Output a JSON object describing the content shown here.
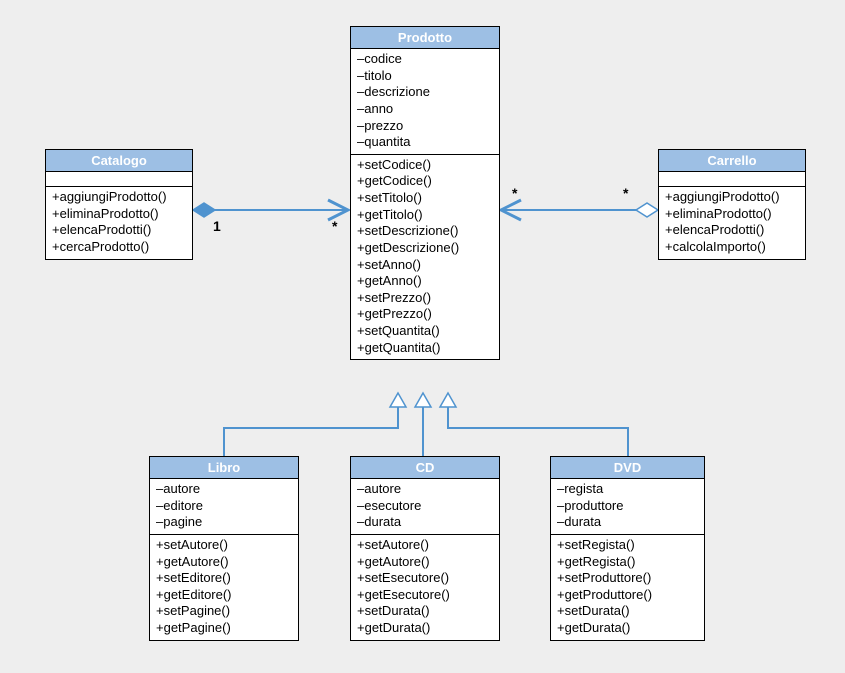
{
  "classes": {
    "prodotto": {
      "title": "Prodotto",
      "attrs": [
        "–codice",
        "–titolo",
        "–descrizione",
        "–anno",
        "–prezzo",
        "–quantita"
      ],
      "ops": [
        "+setCodice()",
        "+getCodice()",
        "+setTitolo()",
        "+getTitolo()",
        "+setDescrizione()",
        "+getDescrizione()",
        "+setAnno()",
        "+getAnno()",
        "+setPrezzo()",
        "+getPrezzo()",
        "+setQuantita()",
        "+getQuantita()"
      ]
    },
    "catalogo": {
      "title": "Catalogo",
      "attrs": [],
      "ops": [
        "+aggiungiProdotto()",
        "+eliminaProdotto()",
        "+elencaProdotti()",
        "+cercaProdotto()"
      ]
    },
    "carrello": {
      "title": "Carrello",
      "attrs": [],
      "ops": [
        "+aggiungiProdotto()",
        "+eliminaProdotto()",
        "+elencaProdotti()",
        "+calcolaImporto()"
      ]
    },
    "libro": {
      "title": "Libro",
      "attrs": [
        "–autore",
        "–editore",
        "–pagine"
      ],
      "ops": [
        "+setAutore()",
        "+getAutore()",
        "+setEditore()",
        "+getEditore()",
        "+setPagine()",
        "+getPagine()"
      ]
    },
    "cd": {
      "title": "CD",
      "attrs": [
        "–autore",
        "–esecutore",
        "–durata"
      ],
      "ops": [
        "+setAutore()",
        "+getAutore()",
        "+setEsecutore()",
        "+getEsecutore()",
        "+setDurata()",
        "+getDurata()"
      ]
    },
    "dvd": {
      "title": "DVD",
      "attrs": [
        "–regista",
        "–produttore",
        "–durata"
      ],
      "ops": [
        "+setRegista()",
        "+getRegista()",
        "+setProduttore()",
        "+getProduttore()",
        "+setDurata()",
        "+getDurata()"
      ]
    }
  },
  "multiplicities": {
    "catalogo_one": "1",
    "prodotto_left_star": "*",
    "prodotto_right_star": "*",
    "carrello_star": "*"
  },
  "chart_data": {
    "type": "uml-class-diagram",
    "classes": [
      {
        "name": "Prodotto",
        "attributes": [
          "codice",
          "titolo",
          "descrizione",
          "anno",
          "prezzo",
          "quantita"
        ],
        "operations": [
          "setCodice",
          "getCodice",
          "setTitolo",
          "getTitolo",
          "setDescrizione",
          "getDescrizione",
          "setAnno",
          "getAnno",
          "setPrezzo",
          "getPrezzo",
          "setQuantita",
          "getQuantita"
        ]
      },
      {
        "name": "Catalogo",
        "attributes": [],
        "operations": [
          "aggiungiProdotto",
          "eliminaProdotto",
          "elencaProdotti",
          "cercaProdotto"
        ]
      },
      {
        "name": "Carrello",
        "attributes": [],
        "operations": [
          "aggiungiProdotto",
          "eliminaProdotto",
          "elencaProdotti",
          "calcolaImporto"
        ]
      },
      {
        "name": "Libro",
        "extends": "Prodotto",
        "attributes": [
          "autore",
          "editore",
          "pagine"
        ],
        "operations": [
          "setAutore",
          "getAutore",
          "setEditore",
          "getEditore",
          "setPagine",
          "getPagine"
        ]
      },
      {
        "name": "CD",
        "extends": "Prodotto",
        "attributes": [
          "autore",
          "esecutore",
          "durata"
        ],
        "operations": [
          "setAutore",
          "getAutore",
          "setEsecutore",
          "getEsecutore",
          "setDurata",
          "getDurata"
        ]
      },
      {
        "name": "DVD",
        "extends": "Prodotto",
        "attributes": [
          "regista",
          "produttore",
          "durata"
        ],
        "operations": [
          "setRegista",
          "getRegista",
          "setProduttore",
          "getProduttore",
          "setDurata",
          "getDurata"
        ]
      }
    ],
    "relationships": [
      {
        "type": "composition",
        "whole": "Catalogo",
        "part": "Prodotto",
        "whole_mult": "1",
        "part_mult": "*"
      },
      {
        "type": "aggregation",
        "whole": "Carrello",
        "part": "Prodotto",
        "whole_mult": "*",
        "part_mult": "*"
      },
      {
        "type": "generalization",
        "parent": "Prodotto",
        "child": "Libro"
      },
      {
        "type": "generalization",
        "parent": "Prodotto",
        "child": "CD"
      },
      {
        "type": "generalization",
        "parent": "Prodotto",
        "child": "DVD"
      }
    ]
  }
}
